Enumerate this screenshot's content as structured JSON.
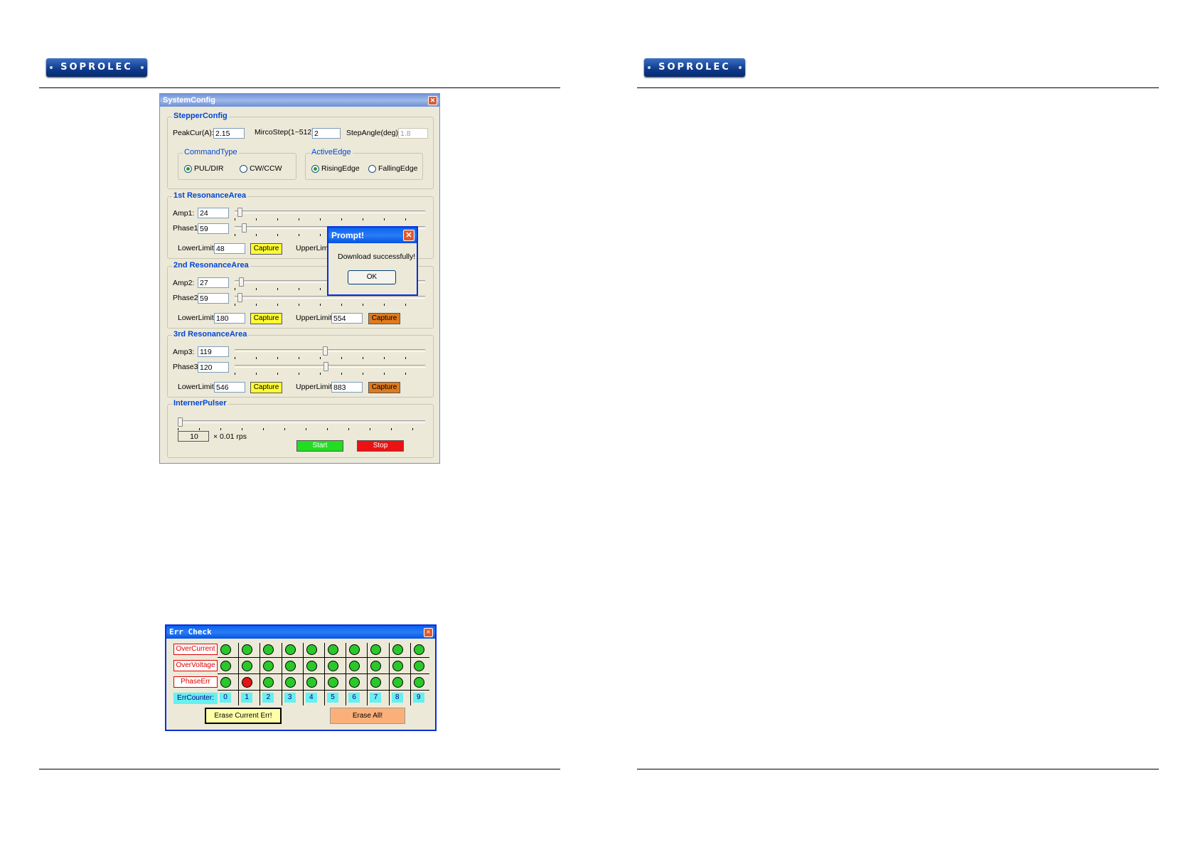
{
  "brand": {
    "logo_text": "SOPROLEC"
  },
  "system_config": {
    "title": "SystemConfig",
    "stepper": {
      "legend": "StepperConfig",
      "peak_label": "PeakCur(A):",
      "peak_value": "2.15",
      "micro_label": "MircoStep(1~512):",
      "micro_value": "2",
      "angle_label": "StepAngle(deg):",
      "angle_value": "1.8",
      "command_legend": "CommandType",
      "command_opt1": "PUL/DIR",
      "command_opt2": "CW/CCW",
      "edge_legend": "ActiveEdge",
      "edge_opt1": "RisingEdge",
      "edge_opt2": "FallingEdge"
    },
    "res1": {
      "legend": "1st ResonanceArea",
      "amp_label": "Amp1:",
      "amp_value": "24",
      "phase_label": "Phase1:",
      "phase_value": "59",
      "lower_label": "LowerLimit:",
      "lower_value": "48",
      "capture": "Capture",
      "upper_label": "UpperLimit:"
    },
    "res2": {
      "legend": "2nd ResonanceArea",
      "amp_label": "Amp2:",
      "amp_value": "27",
      "phase_label": "Phase2:",
      "phase_value": "59",
      "lower_label": "LowerLimit:",
      "lower_value": "180",
      "capture": "Capture",
      "upper_label": "UpperLimit:",
      "upper_value": "554",
      "upper_capture": "Capture"
    },
    "res3": {
      "legend": "3rd ResonanceArea",
      "amp_label": "Amp3:",
      "amp_value": "119",
      "phase_label": "Phase3:",
      "phase_value": "120",
      "lower_label": "LowerLimit:",
      "lower_value": "546",
      "capture": "Capture",
      "upper_label": "UpperLimit:",
      "upper_value": "883",
      "upper_capture": "Capture"
    },
    "pulser": {
      "legend": "InternerPulser",
      "value": "10",
      "unit": "× 0.01 rps",
      "start": "Start",
      "stop": "Stop"
    }
  },
  "prompt": {
    "title": "Prompt!",
    "message": "Download successfully!",
    "ok": "OK"
  },
  "err_check": {
    "title": "Err Check",
    "rows": [
      "OverCurrent",
      "OverVoltage",
      "PhaseErr"
    ],
    "counter_label": "ErrCounter:",
    "counters": [
      "0",
      "1",
      "2",
      "3",
      "4",
      "5",
      "6",
      "7",
      "8",
      "9"
    ],
    "phase_err_active_index": 1,
    "erase_current": "Erase Current Err!",
    "erase_all": "Erase All!"
  },
  "colors": {
    "led_ok": "#2ac82a",
    "led_err": "#e01616",
    "title_blue": "#0046d5"
  }
}
